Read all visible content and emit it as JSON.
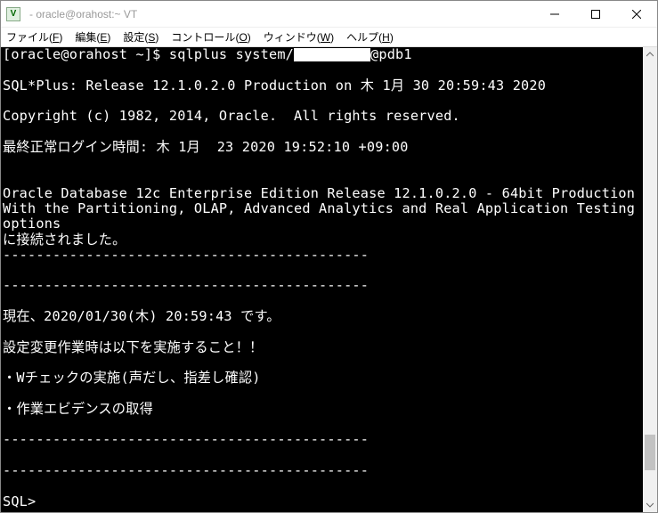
{
  "titlebar": {
    "app_icon_glyph": "V",
    "title": " - oracle@orahost:~ VT"
  },
  "menubar": {
    "items": [
      {
        "label": "ファイル",
        "accel": "F"
      },
      {
        "label": "編集",
        "accel": "E"
      },
      {
        "label": "設定",
        "accel": "S"
      },
      {
        "label": "コントロール",
        "accel": "O"
      },
      {
        "label": "ウィンドウ",
        "accel": "W"
      },
      {
        "label": "ヘルプ",
        "accel": "H"
      }
    ]
  },
  "terminal": {
    "prompt_prefix": "[oracle@orahost ~]$ sqlplus system/",
    "prompt_suffix": "@pdb1",
    "lines": {
      "blank": "",
      "release": "SQL*Plus: Release 12.1.0.2.0 Production on 木 1月 30 20:59:43 2020",
      "copyright": "Copyright (c) 1982, 2014, Oracle.  All rights reserved.",
      "last_login": "最終正常ログイン時間: 木 1月  23 2020 19:52:10 +09:00",
      "db1": "Oracle Database 12c Enterprise Edition Release 12.1.0.2.0 - 64bit Production",
      "db2": "With the Partitioning, OLAP, Advanced Analytics and Real Application Testing options",
      "connected": "に接続されました。",
      "sep1": "--------------------------------------------",
      "sep2": "--------------------------------------------",
      "now": "現在、2020/01/30(木) 20:59:43 です。",
      "instr": "設定変更作業時は以下を実施すること！！",
      "check1": "・Wチェックの実施(声だし、指差し確認)",
      "check2": "・作業エビデンスの取得",
      "sep3": "--------------------------------------------",
      "sep4": "--------------------------------------------",
      "sqlprompt": "SQL>"
    }
  }
}
